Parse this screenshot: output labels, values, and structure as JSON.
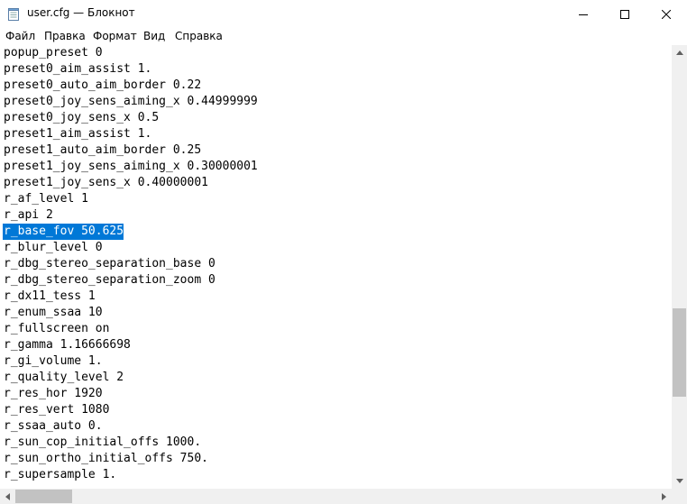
{
  "window": {
    "title": "user.cfg — Блокнот",
    "icon": "notepad-icon",
    "controls": [
      "minimize-icon",
      "maximize-icon",
      "close-icon"
    ]
  },
  "menu": [
    "Файл",
    "Правка",
    "Формат",
    "Вид",
    "Справка"
  ],
  "editor": {
    "lines": [
      "popup_preset 0",
      "preset0_aim_assist 1.",
      "preset0_auto_aim_border 0.22",
      "preset0_joy_sens_aiming_x 0.44999999",
      "preset0_joy_sens_x 0.5",
      "preset1_aim_assist 1.",
      "preset1_auto_aim_border 0.25",
      "preset1_joy_sens_aiming_x 0.30000001",
      "preset1_joy_sens_x 0.40000001",
      "r_af_level 1",
      "r_api 2",
      "r_base_fov 50.625",
      "r_blur_level 0",
      "r_dbg_stereo_separation_base 0",
      "r_dbg_stereo_separation_zoom 0",
      "r_dx11_tess 1",
      "r_enum_ssaa 10",
      "r_fullscreen on",
      "r_gamma 1.16666698",
      "r_gi_volume 1.",
      "r_quality_level 2",
      "r_res_hor 1920",
      "r_res_vert 1080",
      "r_ssaa_auto 0.",
      "r_sun_cop_initial_offs 1000.",
      "r_sun_ortho_initial_offs 750.",
      "r_supersample 1."
    ],
    "selected_line": 11,
    "selection_color": "#0078d7"
  }
}
